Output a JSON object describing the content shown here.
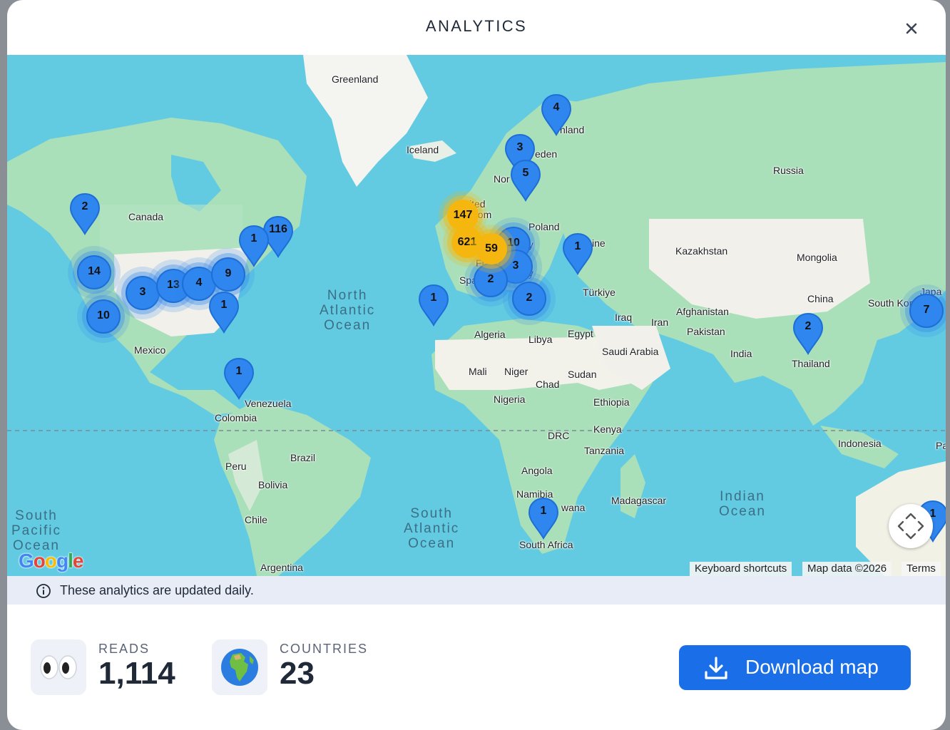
{
  "header": {
    "title": "ANALYTICS",
    "close_icon": "close-icon"
  },
  "map": {
    "country_labels": [
      "Greenland",
      "Iceland",
      "Canada",
      "Russia",
      "Poland",
      "Kazakhstan",
      "Mongolia",
      "China",
      "Türkiye",
      "Iraq",
      "Iran",
      "Afghanistan",
      "Pakistan",
      "India",
      "Thailand",
      "Mexico",
      "Algeria",
      "Libya",
      "Egypt",
      "Saudi Arabia",
      "Mali",
      "Niger",
      "Chad",
      "Sudan",
      "Nigeria",
      "Ethiopia",
      "Venezuela",
      "Colombia",
      "Kenya",
      "DRC",
      "Tanzania",
      "Angola",
      "Brazil",
      "Peru",
      "Bolivia",
      "Chile",
      "Argentina",
      "Namibia",
      "South Africa",
      "Madagascar",
      "Indonesia",
      "nland",
      "eden",
      "Nor",
      "ine",
      "ited",
      "dom",
      "Fra",
      "Spa",
      "aly",
      "ny",
      "South Kor",
      "Japa",
      "wana",
      "Pa"
    ],
    "ocean_labels": {
      "north_atlantic": "North\nAtlantic\nOcean",
      "south_atlantic": "South\nAtlantic\nOcean",
      "south_pacific": "South\nPacific\nOcean",
      "indian": "Indian\nOcean"
    },
    "markers": [
      "4",
      "3",
      "5",
      "2",
      "116",
      "1",
      "14",
      "3",
      "13",
      "4",
      "9",
      "1",
      "10",
      "1",
      "1",
      "10",
      "3",
      "2",
      "2",
      "1",
      "1",
      "2",
      "7",
      "1"
    ],
    "clusters": [
      "147",
      "621",
      "59"
    ],
    "google_logo": "Google",
    "fullscreen_icon": "fullscreen-icon",
    "attribution": {
      "keyboard": "Keyboard shortcuts",
      "mapdata": "Map data ©2026",
      "terms": "Terms"
    }
  },
  "info": {
    "icon": "info-icon",
    "text": "These analytics are updated daily."
  },
  "stats": {
    "reads": {
      "icon": "eyes-icon",
      "label": "READS",
      "value": "1,114"
    },
    "countries": {
      "icon": "globe-icon",
      "label": "COUNTRIES",
      "value": "23"
    }
  },
  "download": {
    "icon": "download-icon",
    "label": "Download map"
  },
  "colors": {
    "ocean": "#62cbe1",
    "land": "#a9dfb9",
    "marker": "#2f86ee",
    "cluster": "#f5b70f",
    "button": "#1a6ee8"
  }
}
